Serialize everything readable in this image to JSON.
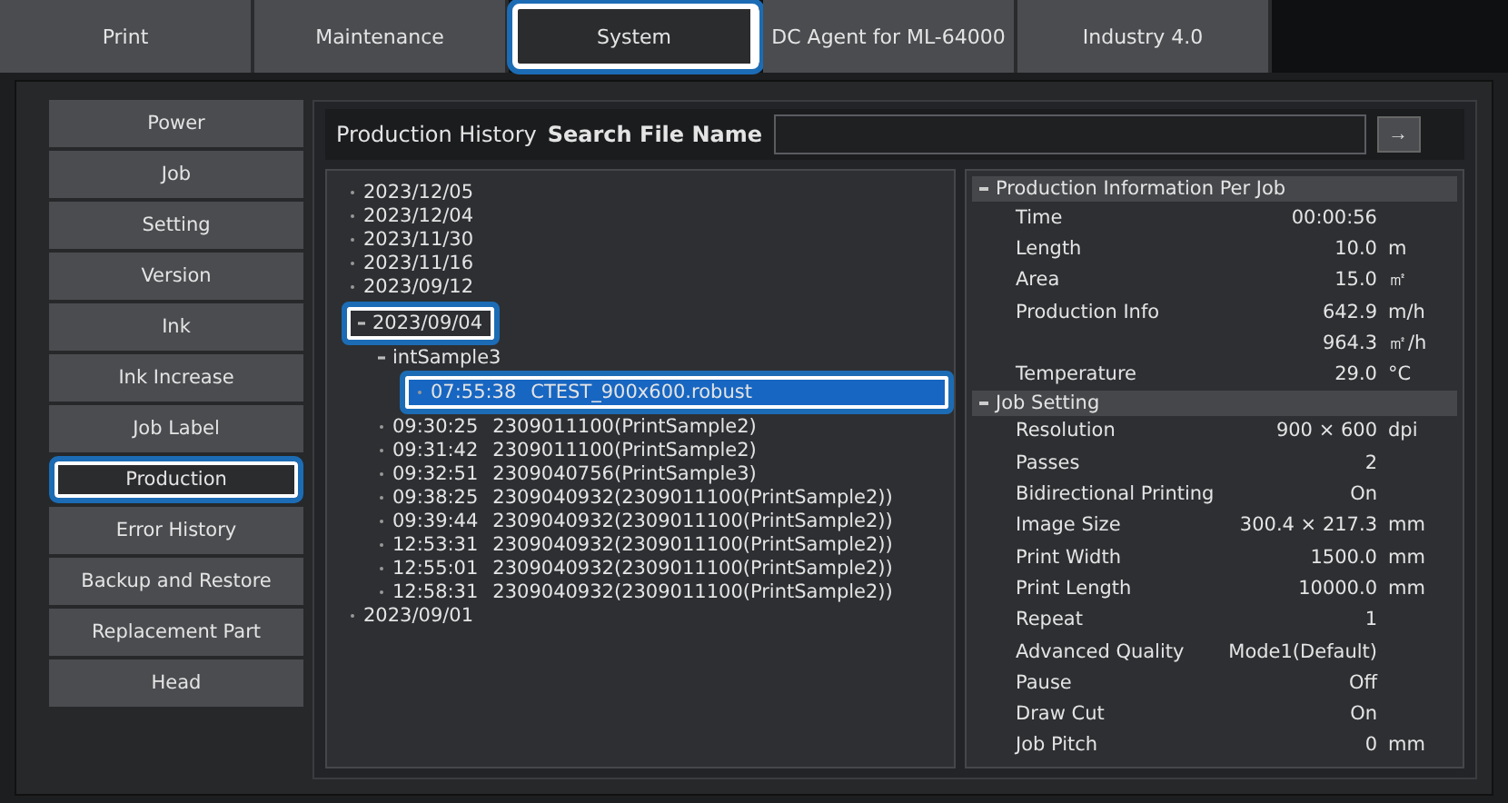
{
  "tabs": [
    {
      "label": "Print",
      "selected": false,
      "highlighted": false
    },
    {
      "label": "Maintenance",
      "selected": false,
      "highlighted": false
    },
    {
      "label": "System",
      "selected": true,
      "highlighted": true
    },
    {
      "label": "DC Agent for ML-64000",
      "selected": false,
      "highlighted": false
    },
    {
      "label": "Industry 4.0",
      "selected": false,
      "highlighted": false
    }
  ],
  "sidebar": {
    "items": [
      {
        "label": "Power",
        "selected": false,
        "highlighted": false
      },
      {
        "label": "Job",
        "selected": false,
        "highlighted": false
      },
      {
        "label": "Setting",
        "selected": false,
        "highlighted": false
      },
      {
        "label": "Version",
        "selected": false,
        "highlighted": false
      },
      {
        "label": "Ink",
        "selected": false,
        "highlighted": false
      },
      {
        "label": "Ink Increase",
        "selected": false,
        "highlighted": false
      },
      {
        "label": "Job Label",
        "selected": false,
        "highlighted": false
      },
      {
        "label": "Production",
        "selected": true,
        "highlighted": true
      },
      {
        "label": "Error History",
        "selected": false,
        "highlighted": false
      },
      {
        "label": "Backup and Restore",
        "selected": false,
        "highlighted": false
      },
      {
        "label": "Replacement Part",
        "selected": false,
        "highlighted": false
      },
      {
        "label": "Head",
        "selected": false,
        "highlighted": false
      }
    ]
  },
  "header": {
    "title": "Production History",
    "search_label": "Search File Name",
    "go_button": "→"
  },
  "tree": [
    {
      "label": "2023/12/05",
      "expanded": false,
      "selected": false,
      "highlighted": false
    },
    {
      "label": "2023/12/04",
      "expanded": false,
      "selected": false,
      "highlighted": false
    },
    {
      "label": "2023/11/30",
      "expanded": false,
      "selected": false,
      "highlighted": false
    },
    {
      "label": "2023/11/16",
      "expanded": false,
      "selected": false,
      "highlighted": false
    },
    {
      "label": "2023/09/12",
      "expanded": false,
      "selected": false,
      "highlighted": false
    },
    {
      "label": "2023/09/04",
      "expanded": true,
      "selected": false,
      "highlighted": true,
      "children": [
        {
          "label": "intSample3",
          "expanded": true,
          "selected": false,
          "highlighted": false,
          "children": [
            {
              "time": "07:55:38",
              "label": "CTEST_900x600.robust",
              "expanded": false,
              "selected": true,
              "highlighted": true
            }
          ]
        },
        {
          "time": "09:30:25",
          "label": "2309011100(PrintSample2)",
          "expanded": false,
          "selected": false,
          "highlighted": false
        },
        {
          "time": "09:31:42",
          "label": "2309011100(PrintSample2)",
          "expanded": false,
          "selected": false,
          "highlighted": false
        },
        {
          "time": "09:32:51",
          "label": "2309040756(PrintSample3)",
          "expanded": false,
          "selected": false,
          "highlighted": false
        },
        {
          "time": "09:38:25",
          "label": "2309040932(2309011100(PrintSample2))",
          "expanded": false,
          "selected": false,
          "highlighted": false
        },
        {
          "time": "09:39:44",
          "label": "2309040932(2309011100(PrintSample2))",
          "expanded": false,
          "selected": false,
          "highlighted": false
        },
        {
          "time": "12:53:31",
          "label": "2309040932(2309011100(PrintSample2))",
          "expanded": false,
          "selected": false,
          "highlighted": false
        },
        {
          "time": "12:55:01",
          "label": "2309040932(2309011100(PrintSample2))",
          "expanded": false,
          "selected": false,
          "highlighted": false
        },
        {
          "time": "12:58:31",
          "label": "2309040932(2309011100(PrintSample2))",
          "expanded": false,
          "selected": false,
          "highlighted": false
        }
      ]
    },
    {
      "label": "2023/09/01",
      "expanded": false,
      "selected": false,
      "highlighted": false
    }
  ],
  "info_sections": [
    {
      "title": "Production Information Per Job",
      "expanded": true,
      "rows": [
        {
          "label": "Time",
          "value": "00:00:56",
          "unit": ""
        },
        {
          "label": "Length",
          "value": "10.0",
          "unit": "m"
        },
        {
          "label": "Area",
          "value": "15.0",
          "unit": "㎡"
        },
        {
          "label": "Production Info",
          "value": "642.9",
          "unit": "m/h"
        },
        {
          "label": "",
          "value": "964.3",
          "unit": "㎡/h"
        },
        {
          "label": "Temperature",
          "value": "29.0",
          "unit": "°C"
        }
      ]
    },
    {
      "title": "Job Setting",
      "expanded": true,
      "rows": [
        {
          "label": "Resolution",
          "value": "900 × 600",
          "unit": "dpi"
        },
        {
          "label": "Passes",
          "value": "2",
          "unit": ""
        },
        {
          "label": "Bidirectional Printing",
          "value": "On",
          "unit": ""
        },
        {
          "label": "Image Size",
          "value": "300.4 × 217.3",
          "unit": "mm"
        },
        {
          "label": "Print Width",
          "value": "1500.0",
          "unit": "mm"
        },
        {
          "label": "Print Length",
          "value": "10000.0",
          "unit": "mm"
        },
        {
          "label": "Repeat",
          "value": "1",
          "unit": ""
        },
        {
          "label": "Advanced Quality",
          "value": "Mode1(Default)",
          "unit": ""
        },
        {
          "label": "Pause",
          "value": "Off",
          "unit": ""
        },
        {
          "label": "Draw Cut",
          "value": "On",
          "unit": ""
        },
        {
          "label": "Job Pitch",
          "value": "0",
          "unit": "mm"
        }
      ]
    }
  ]
}
